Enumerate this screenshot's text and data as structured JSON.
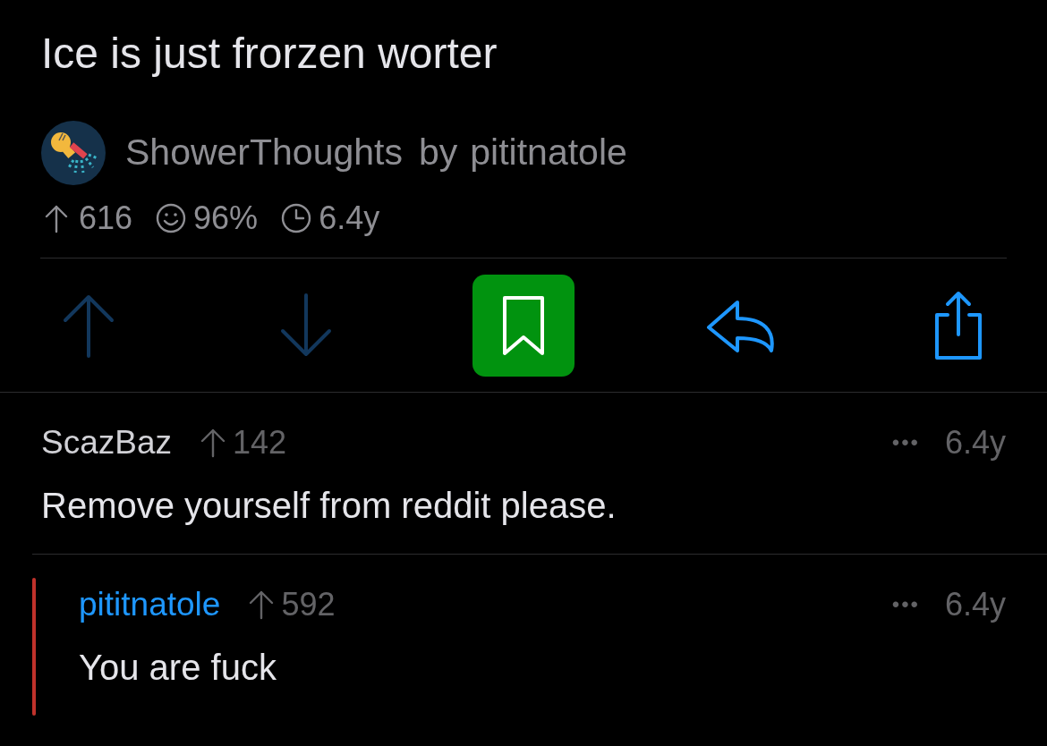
{
  "post": {
    "title": "Ice is just frorzen worter",
    "subreddit": "ShowerThoughts",
    "by": "by",
    "author": "pititnatole",
    "stats": {
      "score": "616",
      "ratio": "96%",
      "age": "6.4y"
    }
  },
  "actions": [
    {
      "kind": "upvote",
      "on": false
    },
    {
      "kind": "downvote",
      "on": false
    },
    {
      "kind": "save",
      "on": true
    },
    {
      "kind": "reply"
    },
    {
      "kind": "share"
    }
  ],
  "comments": [
    {
      "author": "ScazBaz",
      "is_op": false,
      "score": "142",
      "more": "•••",
      "age": "6.4y",
      "body": "Remove yourself from reddit please.",
      "children": [
        {
          "author": "pititnatole",
          "is_op": true,
          "score": "592",
          "more": "•••",
          "age": "6.4y",
          "body": "You are fuck"
        }
      ]
    }
  ]
}
